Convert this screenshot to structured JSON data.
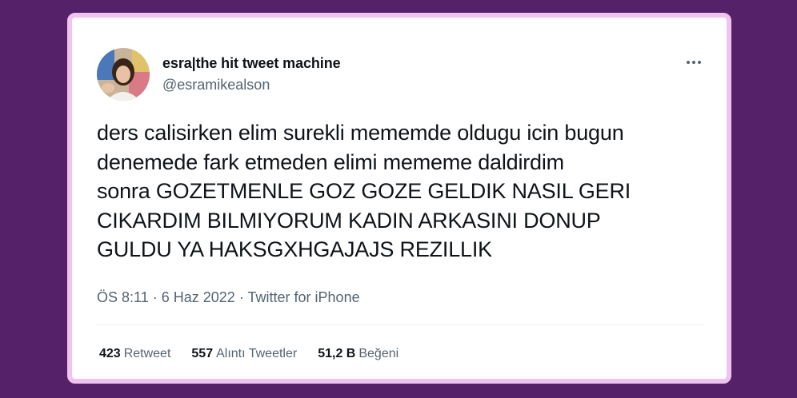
{
  "tweet": {
    "display_name": "esra|the hit tweet machine",
    "handle": "@esramikealson",
    "more_icon": "ellipsis-icon",
    "text": "ders calisirken elim surekli mememde oldugu icin bugun\ndenemede fark etmeden elimi mememe daldirdim\nsonra GOZETMENLE GOZ GOZE GELDIK NASIL GERI\nCIKARDIM BILMIYORUM KADIN ARKASINI DONUP\nGULDU YA HAKSGXHGAJAJS REZILLIK",
    "time": "ÖS 8:11",
    "date": "6 Haz 2022",
    "source": "Twitter for iPhone",
    "separator": "·"
  },
  "stats": {
    "retweets": {
      "count": "423",
      "label": "Retweet"
    },
    "quotes": {
      "count": "557",
      "label": "Alıntı Tweetler"
    },
    "likes": {
      "count": "51,2 B",
      "label": "Beğeni"
    }
  },
  "colors": {
    "background": "#55226a",
    "frame_border": "#f0c4ee",
    "text_primary": "#0f1419",
    "text_secondary": "#536471"
  }
}
